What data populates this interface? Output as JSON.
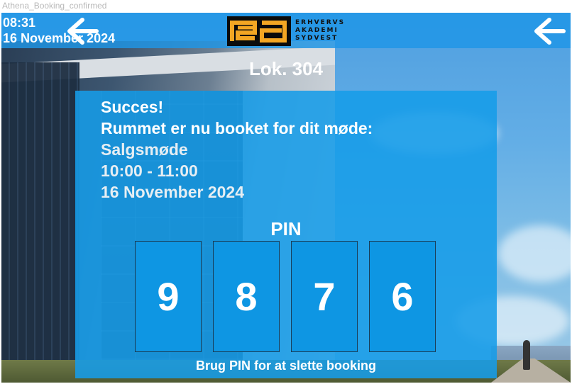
{
  "frame_label": "Athena_Booking_confirmed",
  "header": {
    "time": "08:31",
    "date": "16 November 2024",
    "logo_letters": "ea",
    "logo_lines": [
      "ERHVERVS",
      "AKADEMI",
      "SYDVEST"
    ]
  },
  "room": {
    "title": "Lok. 304"
  },
  "confirmation": {
    "heading": "Succes!",
    "message": "Rummet er nu booket for dit møde:",
    "meeting_name": "Salgsmøde",
    "time_range": "10:00 - 11:00",
    "date": "16 November 2024"
  },
  "pin": {
    "label": "PIN",
    "digits": [
      "9",
      "8",
      "7",
      "6"
    ],
    "hint": "Brug PIN for at slette booking"
  },
  "colors": {
    "accent_blue": "#169ce8",
    "logo_orange": "#f3a623",
    "logo_black": "#0b0b0b"
  },
  "icons": {
    "back": "back-arrow-icon"
  }
}
